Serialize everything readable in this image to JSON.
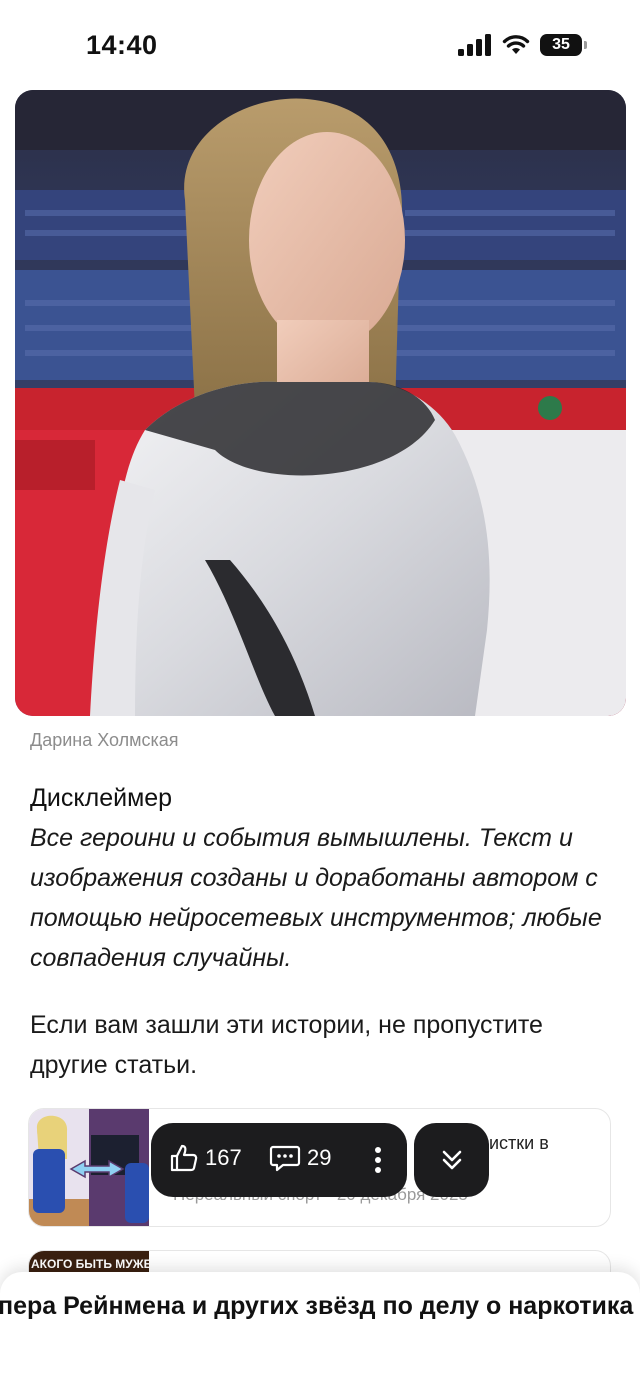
{
  "status_bar": {
    "time": "14:40",
    "battery": "35"
  },
  "article": {
    "image_caption": "Дарина Холмская",
    "disclaimer_title": "Дисклеймер",
    "disclaimer_text": "Все героини и события вымышлены. Текст и изображения созданы и доработаны автором с помощью нейросетевых инструментов; любые совпадения случайны.",
    "promo_text": "Если вам зашли эти истории, не пропустите другие статьи."
  },
  "related": [
    {
      "title_fragment": "истки в",
      "meta": "Нереальный спорт · 20 декабря 2025"
    },
    {
      "thumb_text": "АКОГО БЫТЬ МУЖЕ"
    }
  ],
  "actions": {
    "likes": "167",
    "comments": "29"
  },
  "bottom_sheet": {
    "title": "пера Рейнмена и других звёзд по делу о наркотика"
  },
  "icons": [
    "signal-icon",
    "wifi-icon",
    "battery-icon",
    "thumbs-up-icon",
    "comment-icon",
    "more-vertical-icon",
    "double-chevron-down-icon"
  ]
}
